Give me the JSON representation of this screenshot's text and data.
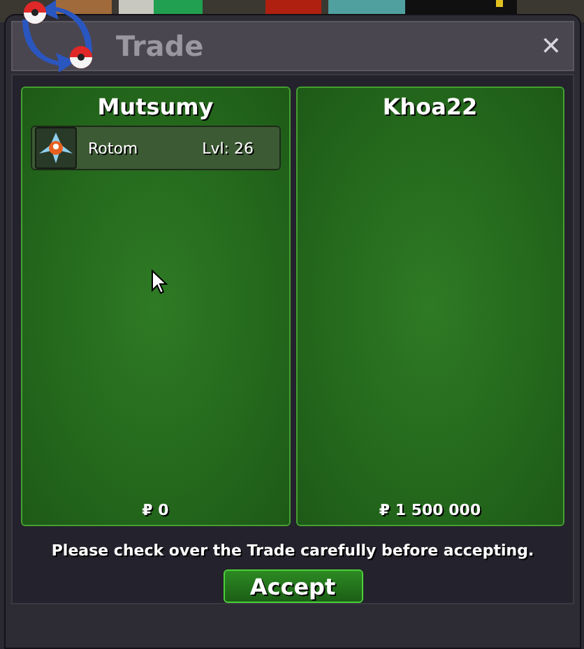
{
  "window": {
    "title": "Trade",
    "close": "✕"
  },
  "traders": [
    {
      "name": "Mutsumy",
      "items": [
        {
          "name": "Rotom",
          "level": "Lvl: 26"
        }
      ],
      "money": "₽ 0"
    },
    {
      "name": "Khoa22",
      "money": "₽ 1 500 000"
    }
  ],
  "message": "Please check over the Trade carefully before accepting.",
  "buttons": [
    "Accept"
  ]
}
